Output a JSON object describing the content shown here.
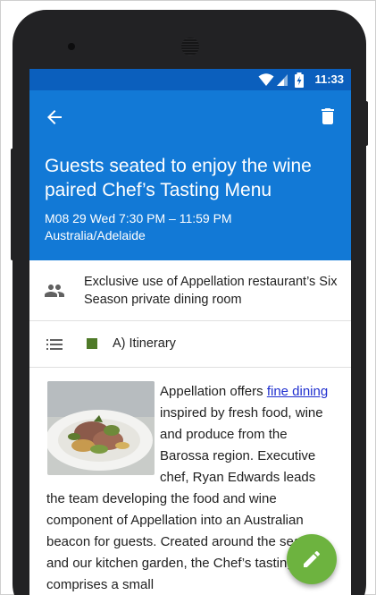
{
  "status_bar": {
    "time": "11:33",
    "icons": [
      "wifi-icon",
      "cell-signal-icon",
      "battery-charging-icon"
    ]
  },
  "app_bar": {
    "back_icon": "arrow-back-icon",
    "delete_icon": "trash-icon",
    "title": "Guests seated to enjoy the wine paired Chef’s Tasting Menu",
    "datetime": "M08 29 Wed 7:30 PM – 11:59 PM",
    "timezone": "Australia/Adelaide"
  },
  "details": {
    "attendees_icon": "people-icon",
    "attendees_text": "Exclusive use of Appellation restaurant’s Six Season private dining room",
    "calendar_icon": "list-icon",
    "calendar_name": "A) Itinerary"
  },
  "description": {
    "intro": "Appellation offers ",
    "link": "fine dining",
    "rest": " inspired by fresh food, wine and produce from the Barossa region. Executive chef, Ryan Edwards leads the team developing the food and wine component of Appellation into an Australian beacon for guests. Created around the season and our kitchen garden, the Chef’s tasting Menu comprises a small"
  },
  "fab": {
    "icon": "pencil-icon"
  },
  "colors": {
    "status_bar": "#0b5fbd",
    "app_bar": "#1279d6",
    "calendar_swatch": "#4f7a28",
    "fab": "#6db33f",
    "link": "#1f2fcf"
  }
}
